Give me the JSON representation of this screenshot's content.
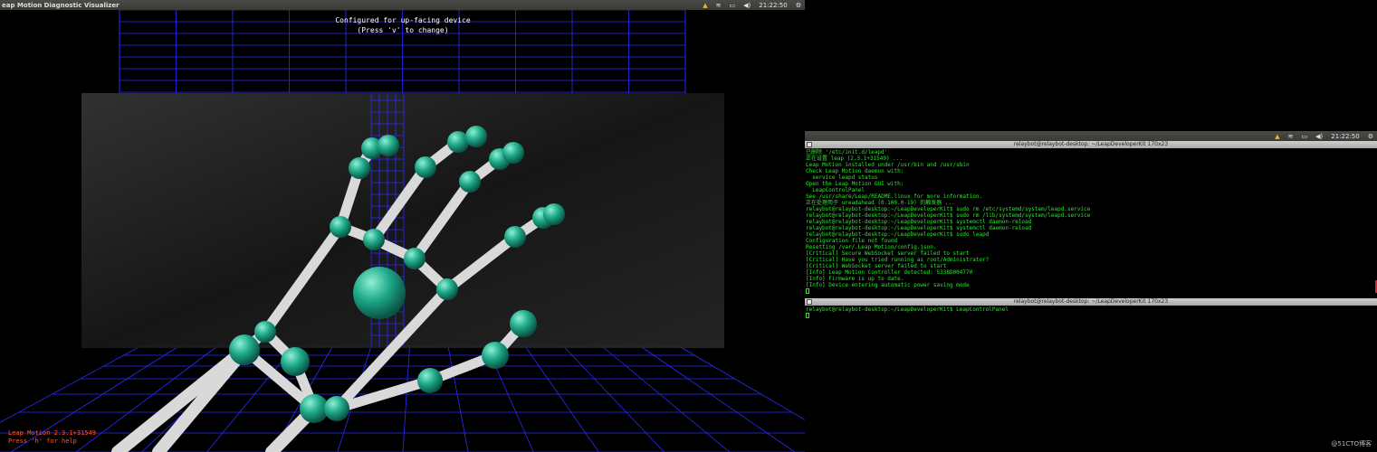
{
  "left_window": {
    "title": "eap Motion Diagnostic Visualizer",
    "tray": {
      "time": "21:22:50"
    },
    "overlay_lines": [
      "Configured for up-facing device",
      "(Press 'v' to change)"
    ],
    "version_lines": [
      "Leap Motion 2.3.1+31549",
      "Press 'h' for help"
    ]
  },
  "right_panel": {
    "tray": {
      "time": "21:22:50"
    }
  },
  "terminal1": {
    "title": "relaybot@relaybot-desktop: ~/LeapDeveloperKit 170x23",
    "lines": [
      "已删除 '/etc/init.d/leapd'",
      "正在设置 leap (2.3.1+31549) ...",
      "Leap Motion installed under /usr/bin and /usr/sbin",
      "Check Leap Motion daemon with:",
      "  service leapd status",
      "Open the Leap Motion GUI with:",
      "  LeapControlPanel",
      "See /usr/share/Leap/README.linux for more information.",
      "正在处理用于 ureadahead (0.100.0-19) 的触发器 ...",
      "relaybot@relaybot-desktop:~/LeapDeveloperKit$ sudo rm /etc/systemd/system/leapd.service",
      "relaybot@relaybot-desktop:~/LeapDeveloperKit$ sudo rm /lib/systemd/system/leapd.service",
      "relaybot@relaybot-desktop:~/LeapDeveloperKit$ systemctl daemon-reload",
      "relaybot@relaybot-desktop:~/LeapDeveloperKit$ systemctl daemon-reload",
      "relaybot@relaybot-desktop:~/LeapDeveloperKit$ sudo leapd",
      "Configuration file not found",
      "Resetting /var/.Leap Motion/config.json.",
      "[Critical] Secure WebSocket server failed to start",
      "[Critical] Have you tried running as root/Administrator?",
      "[Critical] WebSocket server failed to start",
      "[Info] Leap Motion Controller detected: S338D004770",
      "[Info] Firmware is up to date.",
      "[Info] Device entering automatic power saving mode"
    ]
  },
  "terminal2": {
    "title": "relaybot@relaybot-desktop: ~/LeapDeveloperKit 170x23",
    "lines": [
      "relaybot@relaybot-desktop:~/LeapDeveloperKit$ LeapControlPanel"
    ]
  },
  "watermark": "@51CTO博客",
  "colors": {
    "joint": "#1fa98a",
    "bone": "#e6e6e6",
    "grid": "#2b2bff",
    "terminal_text": "#2ee62e",
    "version_text": "#ff5a1f"
  },
  "icons": [
    "leap-app-icon",
    "notification-icon",
    "wifi-icon",
    "battery-icon",
    "volume-icon",
    "power-gear-icon"
  ]
}
